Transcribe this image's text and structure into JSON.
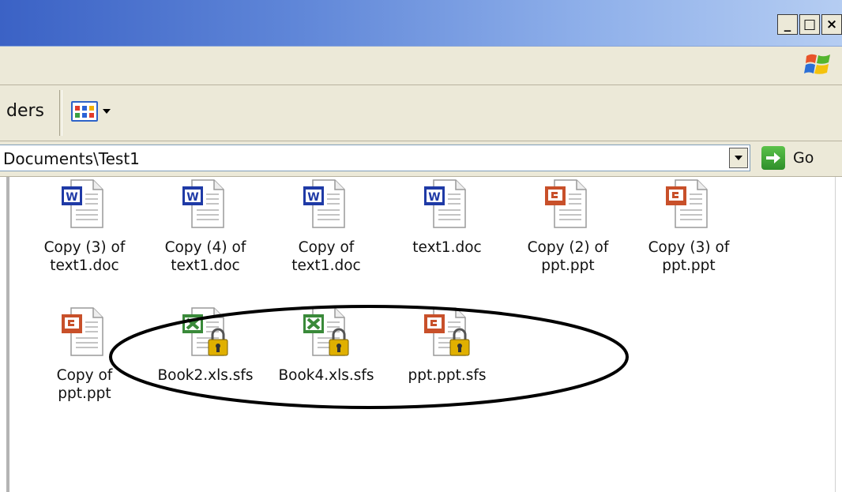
{
  "title_bar": {
    "window_buttons": [
      {
        "name": "minimize",
        "glyph": "_"
      },
      {
        "name": "maximize",
        "glyph": "□"
      },
      {
        "name": "close",
        "glyph": "×"
      }
    ]
  },
  "toolbar": {
    "folders_label": "ders",
    "views_icon": "views-grid-icon"
  },
  "address_bar": {
    "path": "Documents\\Test1",
    "go_label": "Go"
  },
  "files": [
    {
      "label": "Copy (3) of\ntext1.doc",
      "icon": "word-doc-icon",
      "locked": false
    },
    {
      "label": "Copy (4) of\ntext1.doc",
      "icon": "word-doc-icon",
      "locked": false
    },
    {
      "label": "Copy of\ntext1.doc",
      "icon": "word-doc-icon",
      "locked": false
    },
    {
      "label": "text1.doc",
      "icon": "word-doc-icon",
      "locked": false
    },
    {
      "label": "Copy (2) of\nppt.ppt",
      "icon": "ppt-doc-icon",
      "locked": false
    },
    {
      "label": "Copy (3) of\nppt.ppt",
      "icon": "ppt-doc-icon",
      "locked": false
    },
    {
      "label": "Copy of\nppt.ppt",
      "icon": "ppt-doc-icon",
      "locked": false
    },
    {
      "label": "Book2.xls.sfs",
      "icon": "excel-doc-icon",
      "locked": true
    },
    {
      "label": "Book4.xls.sfs",
      "icon": "excel-doc-icon",
      "locked": true
    },
    {
      "label": "ppt.ppt.sfs",
      "icon": "ppt-doc-icon",
      "locked": true
    }
  ],
  "colors": {
    "word": "#1f3aa6",
    "ppt": "#c8502a",
    "excel": "#3a8a3a",
    "lock": "#e0b000"
  }
}
